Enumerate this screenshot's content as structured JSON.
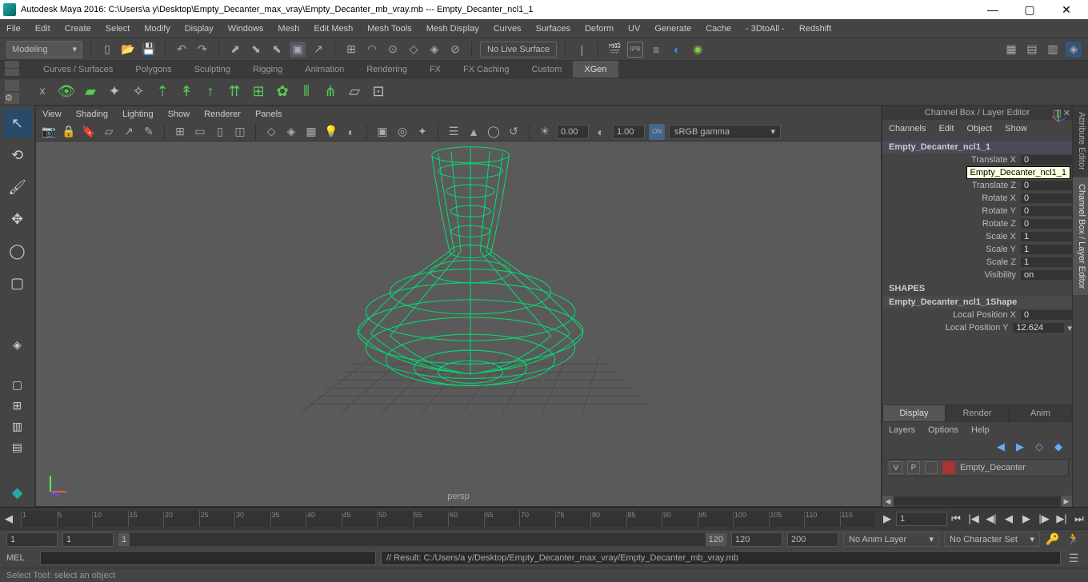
{
  "title": "Autodesk Maya 2016: C:\\Users\\a y\\Desktop\\Empty_Decanter_max_vray\\Empty_Decanter_mb_vray.mb  ---  Empty_Decanter_ncl1_1",
  "menus": [
    "File",
    "Edit",
    "Create",
    "Select",
    "Modify",
    "Display",
    "Windows",
    "Mesh",
    "Edit Mesh",
    "Mesh Tools",
    "Mesh Display",
    "Curves",
    "Surfaces",
    "Deform",
    "UV",
    "Generate",
    "Cache",
    "- 3DtoAll -",
    "Redshift"
  ],
  "mode": "Modeling",
  "live_surface": "No Live Surface",
  "shelf_tabs": [
    "Curves / Surfaces",
    "Polygons",
    "Sculpting",
    "Rigging",
    "Animation",
    "Rendering",
    "FX",
    "FX Caching",
    "Custom",
    "XGen"
  ],
  "active_shelf": 9,
  "vp_menus": [
    "View",
    "Shading",
    "Lighting",
    "Show",
    "Renderer",
    "Panels"
  ],
  "vp_num1": "0.00",
  "vp_num2": "1.00",
  "color_mgmt_label": "ON",
  "color_mgmt": "sRGB gamma",
  "vp_camera": "persp",
  "right_title": "Channel Box / Layer Editor",
  "right_tabs": [
    "Channels",
    "Edit",
    "Object",
    "Show"
  ],
  "obj_name": "Empty_Decanter_ncl1_1",
  "tooltip": "Empty_Decanter_ncl1_1",
  "channels": [
    {
      "label": "Translate X",
      "value": "0"
    },
    {
      "label": "",
      "value": ""
    },
    {
      "label": "Translate Z",
      "value": "0"
    },
    {
      "label": "Rotate X",
      "value": "0"
    },
    {
      "label": "Rotate Y",
      "value": "0"
    },
    {
      "label": "Rotate Z",
      "value": "0"
    },
    {
      "label": "Scale X",
      "value": "1"
    },
    {
      "label": "Scale Y",
      "value": "1"
    },
    {
      "label": "Scale Z",
      "value": "1"
    },
    {
      "label": "Visibility",
      "value": "on"
    }
  ],
  "shapes_label": "SHAPES",
  "shape_name": "Empty_Decanter_ncl1_1Shape",
  "shape_channels": [
    {
      "label": "Local Position X",
      "value": "0"
    },
    {
      "label": "Local Position Y",
      "value": "12.624"
    }
  ],
  "layer_tabs": [
    "Display",
    "Render",
    "Anim"
  ],
  "layer_menus": [
    "Layers",
    "Options",
    "Help"
  ],
  "layer": {
    "v": "V",
    "p": "P",
    "name": "Empty_Decanter"
  },
  "vert_tabs": [
    "Attribute Editor",
    "Channel Box / Layer Editor"
  ],
  "time_ticks": [
    "1",
    "5",
    "10",
    "15",
    "20",
    "25",
    "30",
    "35",
    "40",
    "45",
    "50",
    "55",
    "60",
    "65",
    "70",
    "75",
    "80",
    "85",
    "90",
    "95",
    "100",
    "105",
    "110",
    "115"
  ],
  "time_current": "1",
  "range": {
    "r1": "1",
    "r2": "1",
    "rs": "1",
    "re": "120",
    "r3": "120",
    "r4": "200"
  },
  "anim_layer_sel": "No Anim Layer",
  "char_set_sel": "No Character Set",
  "cmd_label": "MEL",
  "cmd_result": "// Result: C:/Users/a y/Desktop/Empty_Decanter_max_vray/Empty_Decanter_mb_vray.mb",
  "status": "Select Tool: select an object"
}
